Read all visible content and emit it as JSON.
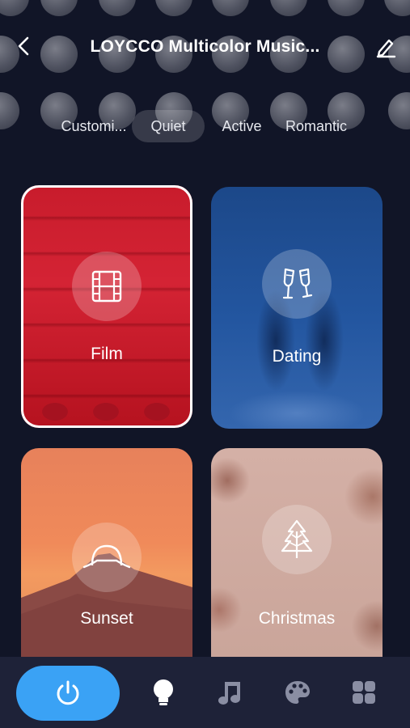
{
  "header": {
    "title": "LOYCCO Multicolor Music...",
    "back_icon": "back-arrow-icon",
    "edit_icon": "edit-pencil-icon"
  },
  "tabs": [
    {
      "label": "Customi...",
      "active": false
    },
    {
      "label": "Quiet",
      "active": true
    },
    {
      "label": "Active",
      "active": false
    },
    {
      "label": "Romantic",
      "active": false
    }
  ],
  "scenes": [
    {
      "label": "Film",
      "icon": "film-icon",
      "selected": true,
      "color": "#c81c2c"
    },
    {
      "label": "Dating",
      "icon": "champagne-glasses-icon",
      "selected": false,
      "color": "#1f4f94"
    },
    {
      "label": "Sunset",
      "icon": "sunset-icon",
      "selected": false,
      "color": "#e9825c"
    },
    {
      "label": "Christmas",
      "icon": "christmas-tree-icon",
      "selected": false,
      "color": "#cfaaa0"
    }
  ],
  "bottom_nav": {
    "power_icon": "power-icon",
    "items": [
      "bulb-icon",
      "music-note-icon",
      "palette-icon",
      "grid-icon"
    ],
    "accent_color": "#3aa2f5"
  }
}
